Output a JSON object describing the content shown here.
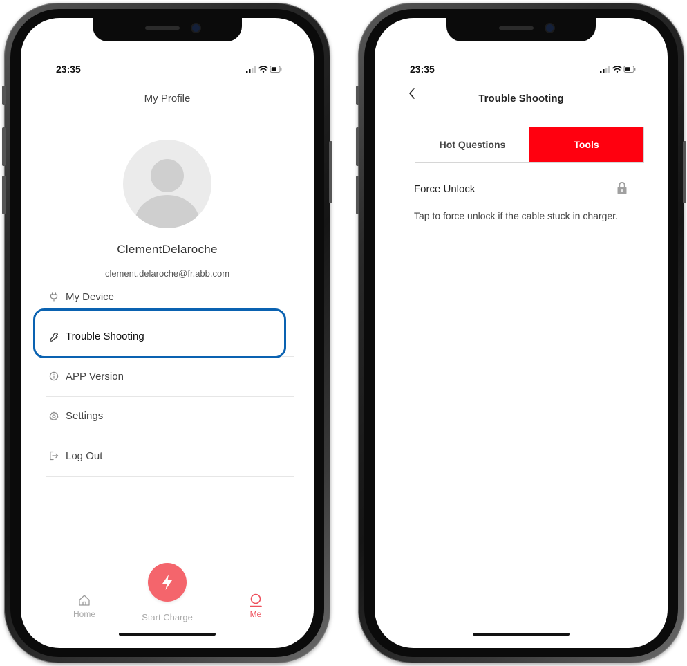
{
  "left_screen": {
    "status_time": "23:35",
    "title": "My Profile",
    "user": {
      "name": "ClementDelaroche",
      "email": "clement.delaroche@fr.abb.com"
    },
    "menu": [
      {
        "label": "My Device",
        "icon": "plug-icon"
      },
      {
        "label": "Trouble Shooting",
        "icon": "wrench-icon"
      },
      {
        "label": "APP Version",
        "icon": "info-icon"
      },
      {
        "label": "Settings",
        "icon": "gear-icon"
      },
      {
        "label": "Log Out",
        "icon": "logout-icon"
      }
    ],
    "highlighted_item": "Trouble Shooting",
    "tabbar": {
      "home": "Home",
      "start_charge": "Start Charge",
      "me": "Me",
      "selected": "Me"
    }
  },
  "right_screen": {
    "status_time": "23:35",
    "title": "Trouble Shooting",
    "tabs": [
      {
        "label": "Hot Questions",
        "active": false
      },
      {
        "label": "Tools",
        "active": true
      }
    ],
    "force_unlock": {
      "title": "Force Unlock",
      "description": "Tap to force unlock if the cable stuck in charger.",
      "icon": "lock-icon"
    }
  },
  "colors": {
    "brand_red": "#ff000f",
    "accent_coral": "#f4656c",
    "highlight_blue": "#0a62b1"
  }
}
